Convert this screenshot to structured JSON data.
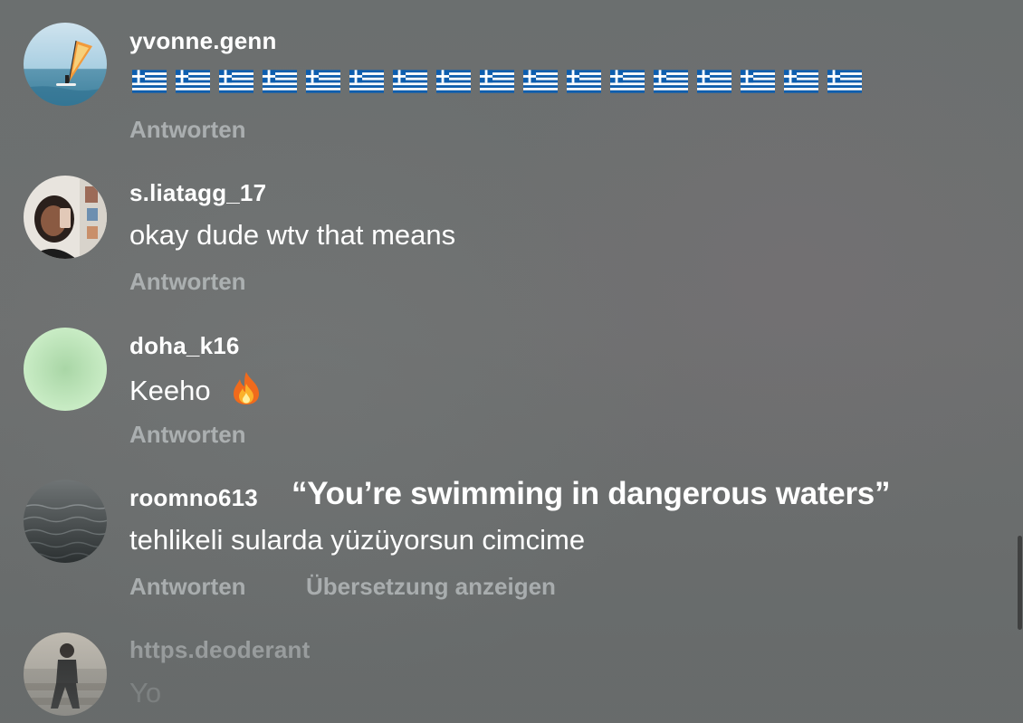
{
  "comments": [
    {
      "username": "yvonne.genn",
      "text_icon": "greek-flag-emoji x17",
      "flag_count": 17,
      "reply_label": "Antworten"
    },
    {
      "username": "s.liatagg_17",
      "text": "okay dude wtv that means",
      "reply_label": "Antworten"
    },
    {
      "username": "doha_k16",
      "text": "Keeho",
      "text_icon": "fire-emoji",
      "reply_label": "Antworten"
    },
    {
      "username": "roomno613",
      "text": "tehlikeli sularda yüzüyorsun cimcime",
      "reply_label": "Antworten",
      "translate_label": "Übersetzung anzeigen"
    },
    {
      "username": "https.deoderant",
      "text": "Yo"
    }
  ],
  "overlay_caption": "“You’re swimming in dangerous waters”",
  "colors": {
    "background": "#6c7070",
    "text": "#ffffff",
    "muted": "#b9bec1",
    "flag_blue": "#0d5eaf"
  }
}
